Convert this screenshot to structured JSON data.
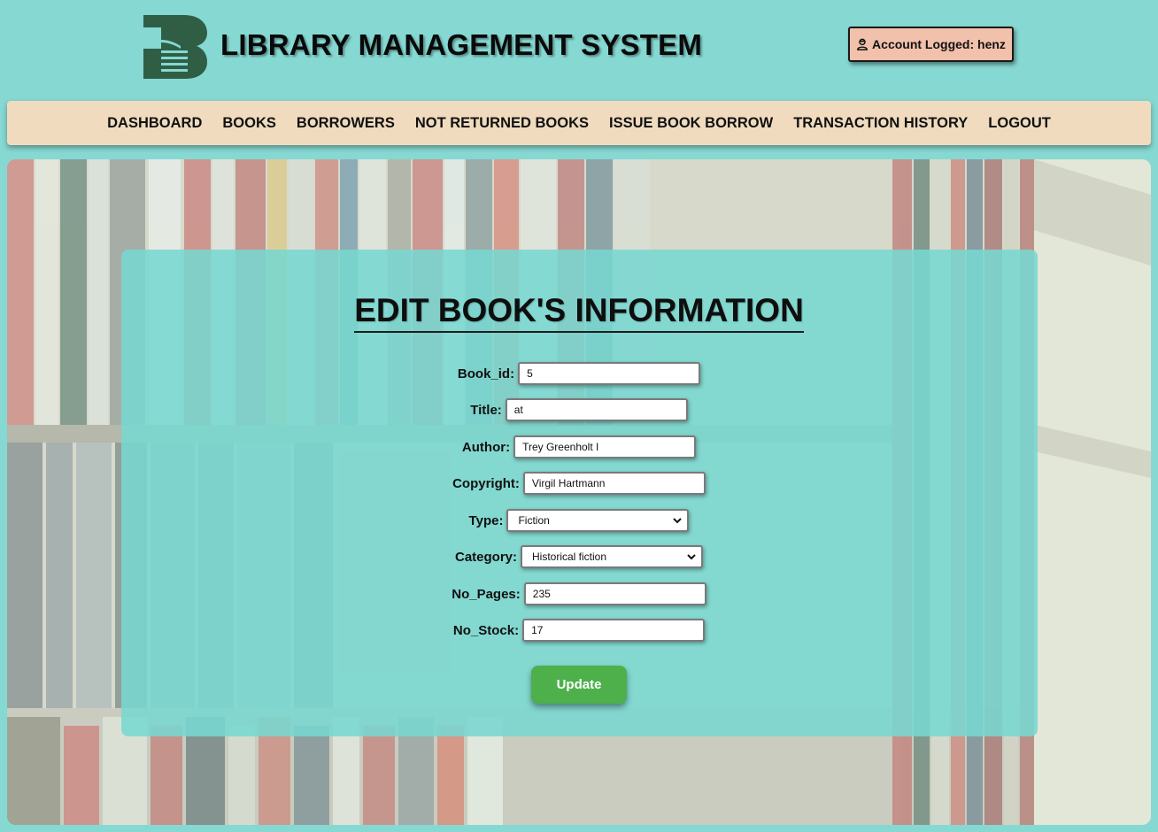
{
  "header": {
    "title": "LIBRARY MANAGEMENT SYSTEM",
    "account_label": "Account Logged: henz"
  },
  "nav": {
    "items": [
      "DASHBOARD",
      "BOOKS",
      "BORROWERS",
      "NOT RETURNED BOOKS",
      "ISSUE BOOK BORROW",
      "TRANSACTION HISTORY",
      "LOGOUT"
    ]
  },
  "form": {
    "title": "EDIT BOOK'S INFORMATION",
    "fields": {
      "book_id": {
        "label": "Book_id:",
        "value": "5"
      },
      "title": {
        "label": "Title:",
        "value": "at"
      },
      "author": {
        "label": "Author:",
        "value": "Trey Greenholt I"
      },
      "copyright": {
        "label": "Copyright:",
        "value": "Virgil Hartmann"
      },
      "type": {
        "label": "Type:",
        "value": "Fiction"
      },
      "category": {
        "label": "Category:",
        "value": "Historical fiction"
      },
      "no_pages": {
        "label": "No_Pages:",
        "value": "235"
      },
      "no_stock": {
        "label": "No_Stock:",
        "value": "17"
      }
    },
    "submit_label": "Update"
  },
  "colors": {
    "page_bg": "#86d8d2",
    "nav_bg": "#f0dbbe",
    "account_bg": "#f2c1ab",
    "panel_bg": "#78d7d0",
    "button_bg": "#4eb04b",
    "logo": "#2f5e45"
  },
  "icons": {
    "logo": "library-logo-icon",
    "account": "user-icon",
    "dropdown": "chevron-down-icon"
  }
}
